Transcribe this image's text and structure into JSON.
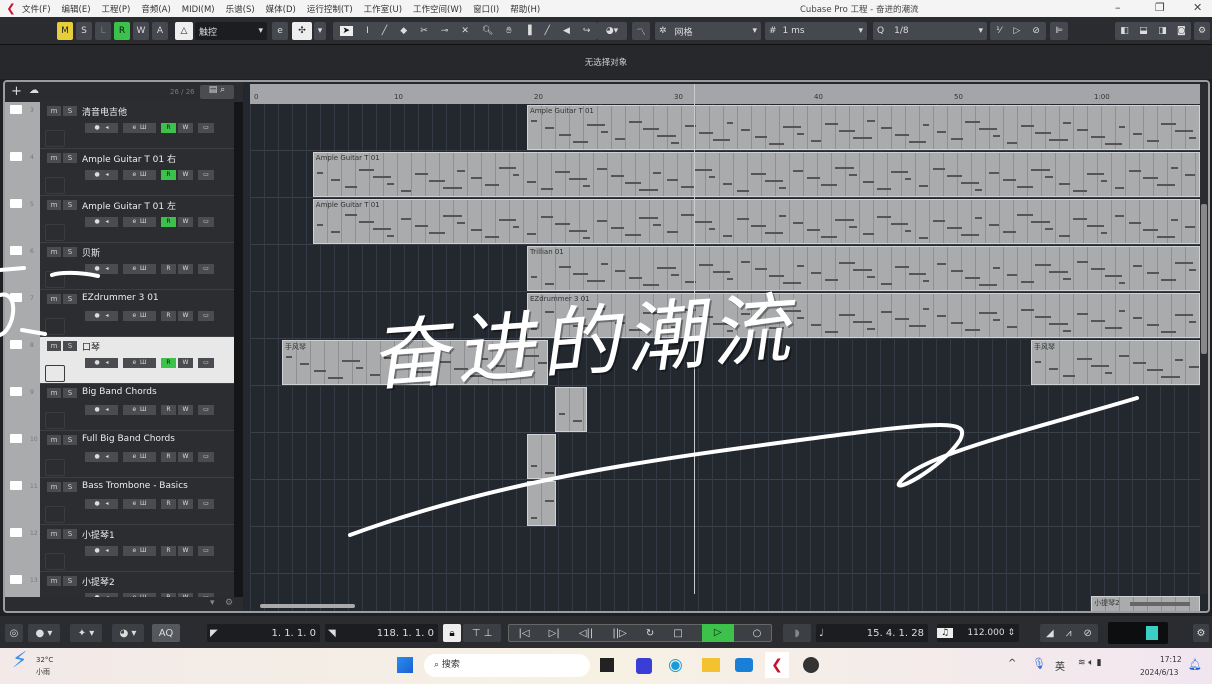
{
  "window": {
    "title": "Cubase Pro 工程 - 奋进的潮流",
    "minimize": "–",
    "restore": "❐",
    "close": "✕"
  },
  "menu": [
    "文件(F)",
    "编辑(E)",
    "工程(P)",
    "音频(A)",
    "MIDI(M)",
    "乐谱(S)",
    "媒体(D)",
    "运行控制(T)",
    "工作室(U)",
    "工作空间(W)",
    "窗口(I)",
    "帮助(H)"
  ],
  "toolbar": {
    "m": "M",
    "s": "S",
    "l": "L",
    "r": "R",
    "w": "W",
    "a": "A",
    "automation_mode": "触控",
    "grid_type": "网格",
    "grid_value": "1 ms",
    "quantize": "1/8"
  },
  "info_line": "无选择对象",
  "track_list": {
    "count": "26 / 26",
    "add": "+"
  },
  "ruler": [
    "0",
    "10",
    "20",
    "30",
    "40",
    "50",
    "1:00"
  ],
  "tracks": [
    {
      "num": "3",
      "name": "清音电吉他",
      "r_on": true
    },
    {
      "num": "4",
      "name": "Ample Guitar T 01 右",
      "r_on": true
    },
    {
      "num": "5",
      "name": "Ample Guitar T 01 左",
      "r_on": true
    },
    {
      "num": "6",
      "name": "贝斯",
      "r_on": false
    },
    {
      "num": "7",
      "name": "EZdrummer 3 01",
      "r_on": false
    },
    {
      "num": "8",
      "name": "口琴",
      "r_on": true,
      "selected": true
    },
    {
      "num": "9",
      "name": "Big Band Chords",
      "r_on": false
    },
    {
      "num": "10",
      "name": "Full Big Band Chords",
      "r_on": false
    },
    {
      "num": "11",
      "name": "Bass Trombone - Basics",
      "r_on": false
    },
    {
      "num": "12",
      "name": "小提琴1",
      "r_on": false
    },
    {
      "num": "13",
      "name": "小提琴2",
      "r_on": false
    }
  ],
  "track_buttons": {
    "m": "m",
    "s": "S",
    "e": "e",
    "r": "R",
    "w": "W"
  },
  "clips": [
    {
      "track": 0,
      "start": 19.5,
      "end": 70,
      "label": "Ample Guitar T 01"
    },
    {
      "track": 1,
      "start": 4.2,
      "end": 70,
      "label": "Ample Guitar T 01"
    },
    {
      "track": 2,
      "start": 4.2,
      "end": 70,
      "label": "Ample Guitar T 01"
    },
    {
      "track": 3,
      "start": 19.5,
      "end": 70,
      "label": "Trillian 01"
    },
    {
      "track": 4,
      "start": 19.5,
      "end": 70,
      "label": "EZdrummer 3 01"
    },
    {
      "track": 5,
      "start": 2,
      "end": 21,
      "label": "手风琴"
    },
    {
      "track": 5,
      "start": 55.5,
      "end": 70,
      "label": "手风琴"
    },
    {
      "track": 6,
      "start": 21.5,
      "end": 23.8,
      "label": ""
    },
    {
      "track": 7,
      "start": 19.5,
      "end": 21.6,
      "label": ""
    },
    {
      "track": 8,
      "start": 19.5,
      "end": 21.6,
      "label": ""
    },
    {
      "track": 10,
      "start": 59.8,
      "end": 70,
      "label": "小提琴2"
    }
  ],
  "transport": {
    "left_locator": "1. 1. 1.   0",
    "right_locator": "118. 1. 1.   0",
    "position": "15. 4. 1. 28",
    "tempo": "112.000",
    "aq": "AQ"
  },
  "taskbar": {
    "weather_temp": "32°C",
    "weather_desc": "小雨",
    "search": "搜索",
    "ime": "英",
    "time": "17:12",
    "date": "2024/6/13"
  },
  "handwriting": "奋进的潮流",
  "colors": {
    "accent_green": "#3cc24a",
    "mute_yellow": "#e6cf3a",
    "meter": "#3bb6c2"
  }
}
